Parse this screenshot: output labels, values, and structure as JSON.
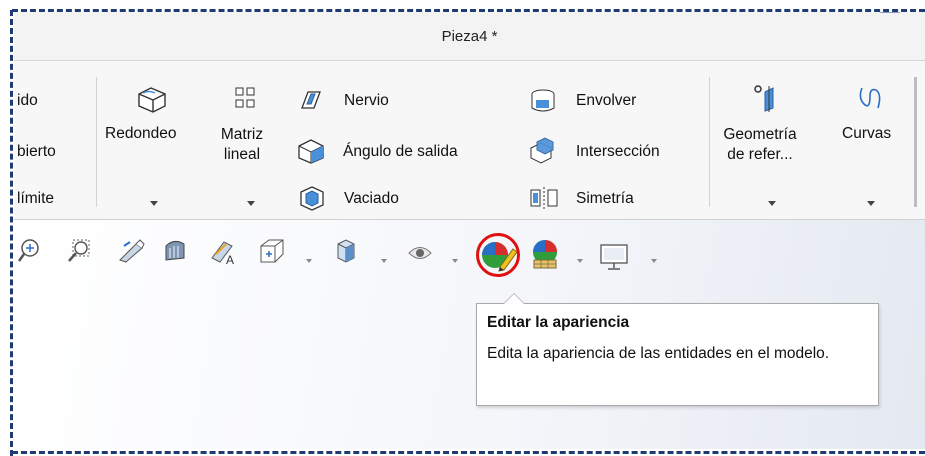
{
  "window": {
    "title": "Pieza4 *"
  },
  "ribbon": {
    "partial_labels": [
      "ido",
      "bierto",
      "límite"
    ],
    "redondeo": "Redondeo",
    "matriz_lineal_1": "Matriz",
    "matriz_lineal_2": "lineal",
    "nervio": "Nervio",
    "angulo_salida": "Ángulo de salida",
    "vaciado": "Vaciado",
    "envolver": "Envolver",
    "interseccion": "Intersección",
    "simetria": "Simetría",
    "geometria_1": "Geometría",
    "geometria_2": "de refer...",
    "curvas": "Curvas"
  },
  "view_toolbar": {
    "icons": [
      "zoom-to-fit-icon",
      "zoom-to-area-icon",
      "previous-view-icon",
      "section-view-icon",
      "dynamic-annotation-icon",
      "view-orientation-icon",
      "display-style-icon",
      "hide-show-items-icon",
      "edit-appearance-icon",
      "apply-scene-icon",
      "view-settings-icon"
    ]
  },
  "tooltip": {
    "title": "Editar la apariencia",
    "description": "Edita la apariencia de las entidades en el modelo."
  },
  "colors": {
    "highlight": "#e01010",
    "frame": "#1f3b73",
    "accent_blue": "#1e6fd0"
  }
}
